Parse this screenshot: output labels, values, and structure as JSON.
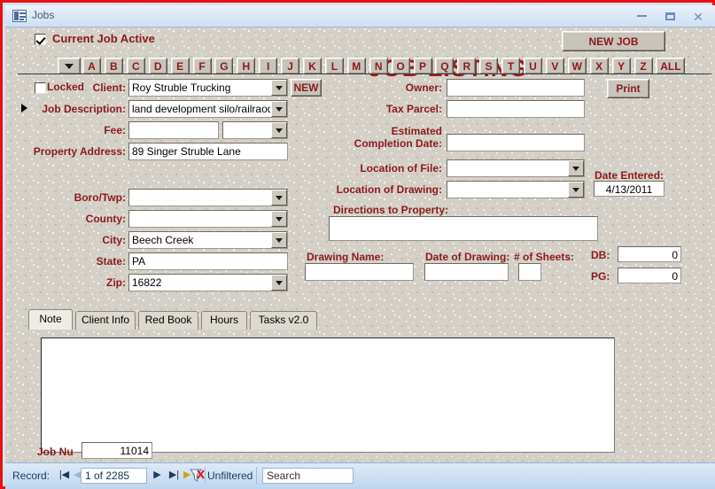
{
  "window": {
    "title": "Jobs",
    "icon": "form-datasheet-icon",
    "minimize": "minimize-icon",
    "maximize": "maximize-icon",
    "close": "close-icon",
    "border_color": "#e81010"
  },
  "header": {
    "active_checkbox_label": "Current Job Active",
    "active_checked": true,
    "title": "JOB LISTING",
    "new_job_button": "NEW JOB",
    "title_color": "#9e1b1b"
  },
  "alpha_bar": {
    "dropdown": "chevron-down-icon",
    "letters": [
      "A",
      "B",
      "C",
      "D",
      "E",
      "F",
      "G",
      "H",
      "I",
      "J",
      "K",
      "L",
      "M",
      "N",
      "O",
      "P",
      "Q",
      "R",
      "S",
      "T",
      "U",
      "V",
      "W",
      "X",
      "Y",
      "Z"
    ],
    "all_label": "ALL"
  },
  "form": {
    "locked_label": "Locked",
    "locked_checked": false,
    "client_label": "Client:",
    "client_value": "Roy Struble Trucking",
    "new_button": "NEW",
    "job_description_label": "Job Description:",
    "job_description_value": "land development silo/railraod tra",
    "fee_label": "Fee:",
    "fee_value": "",
    "fee_type_value": "",
    "property_address_label": "Property Address:",
    "property_address_value": "89 Singer Struble Lane",
    "boro_twp_label": "Boro/Twp:",
    "boro_twp_value": "",
    "county_label": "County:",
    "county_value": "",
    "city_label": "City:",
    "city_value": "Beech Creek",
    "state_label": "State:",
    "state_value": "PA",
    "zip_label": "Zip:",
    "zip_value": "16822",
    "owner_label": "Owner:",
    "owner_value": "",
    "tax_parcel_label": "Tax Parcel:",
    "tax_parcel_value": "",
    "estimated_label_line1": "Estimated",
    "estimated_label_line2": "Completion Date:",
    "estimated_value": "",
    "location_of_file_label": "Location of File:",
    "location_of_file_value": "",
    "location_of_drawing_label": "Location of Drawing:",
    "location_of_drawing_value": "",
    "directions_label": "Directions to Property:",
    "directions_value": "",
    "print_button": "Print",
    "date_entered_label": "Date Entered:",
    "date_entered_value": "4/13/2011",
    "drawing_name_label": "Drawing Name:",
    "drawing_name_value": "",
    "date_of_drawing_label": "Date of Drawing:",
    "date_of_drawing_value": "",
    "sheets_label": "# of Sheets:",
    "sheets_value": "",
    "db_label": "DB:",
    "db_value": "0",
    "pg_label": "PG:",
    "pg_value": "0",
    "job_number_label": "Job Nu",
    "job_number_value": "11014"
  },
  "tabs": {
    "items": [
      "Note",
      "Client Info",
      "Red Book",
      "Hours",
      "Tasks v2.0"
    ],
    "active": "Note",
    "note_value": ""
  },
  "navbar": {
    "record_label": "Record:",
    "first_icon": "first-record-icon",
    "prev_icon": "previous-record-icon",
    "position": "1 of 2285",
    "next_icon": "next-record-icon",
    "last_icon": "last-record-icon",
    "new_icon": "new-record-icon",
    "filter_icon": "filter-off-icon",
    "filter_label": "Unfiltered",
    "search_placeholder": "Search",
    "search_value": "Search"
  }
}
